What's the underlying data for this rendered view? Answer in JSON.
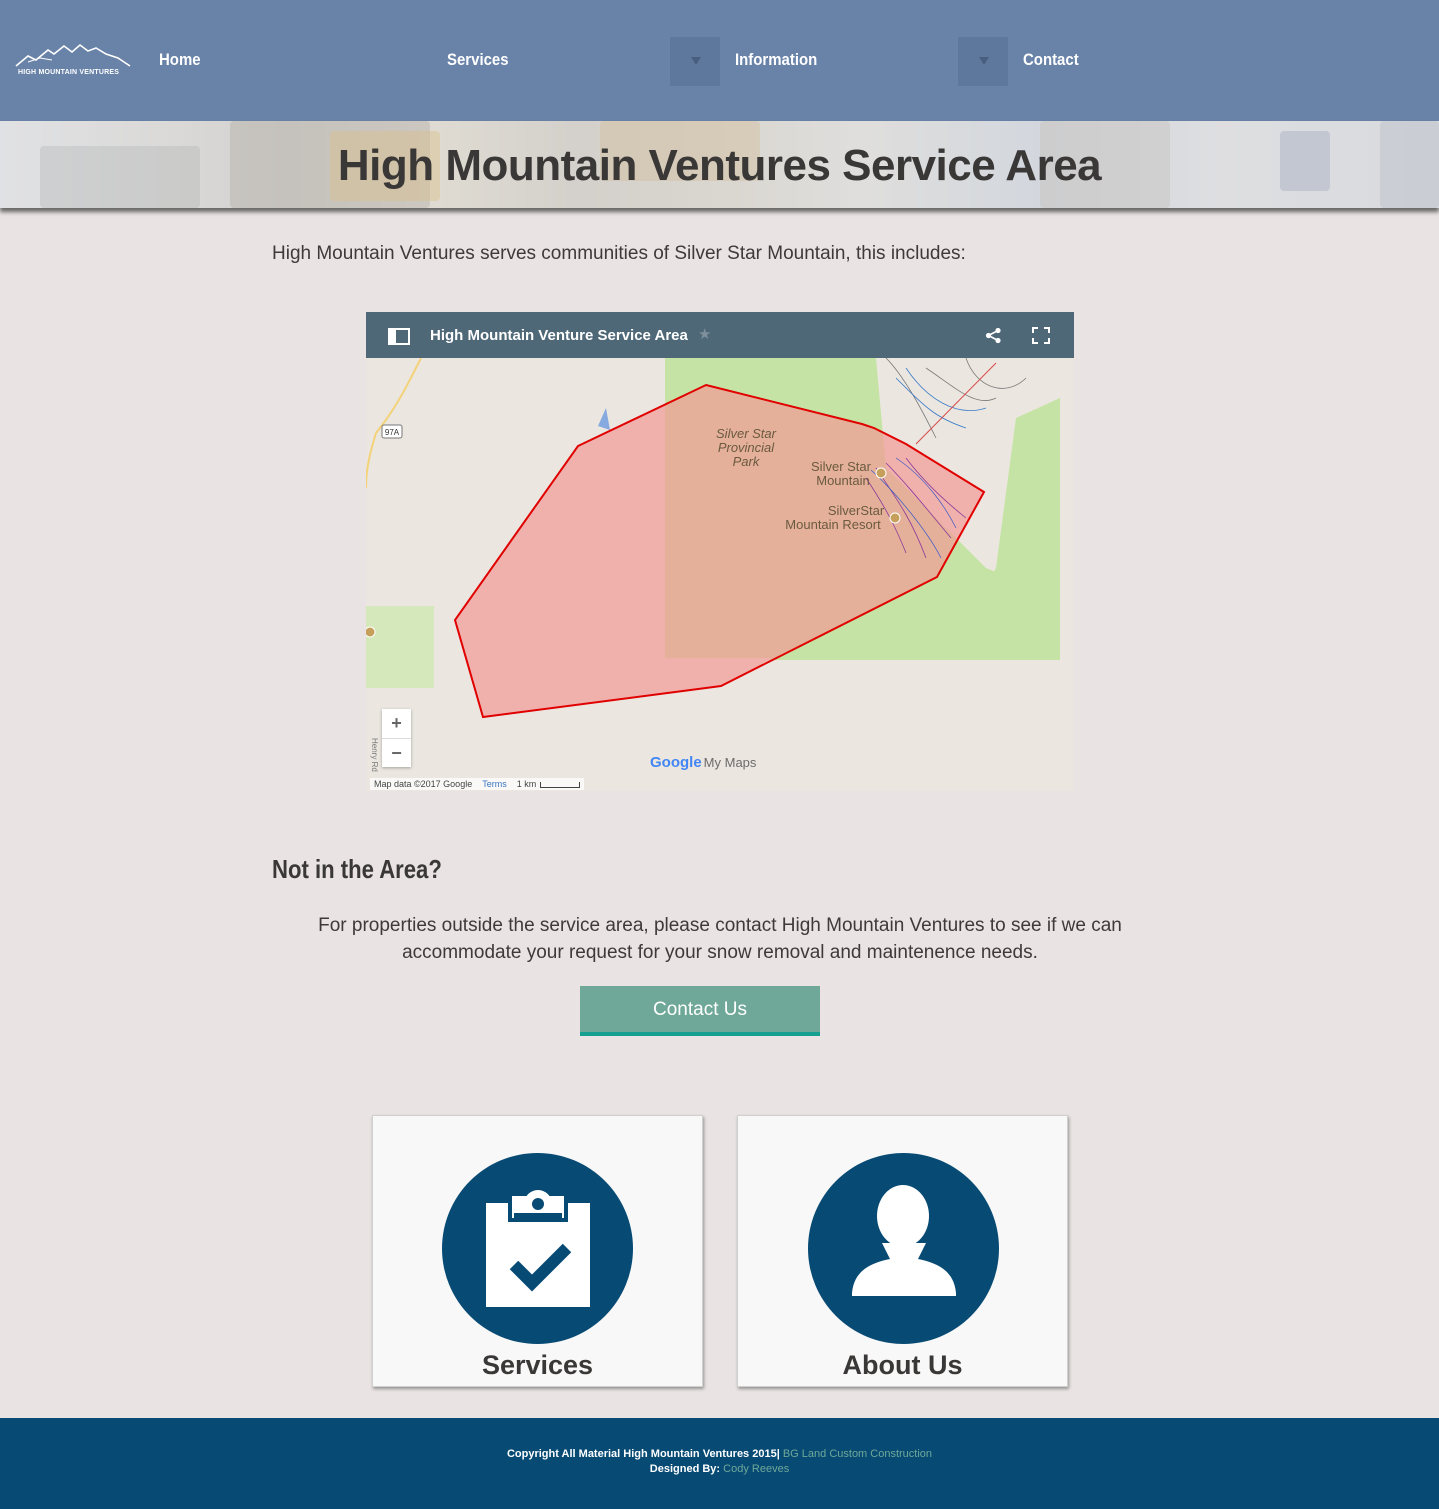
{
  "nav": {
    "logo_text": "HIGH MOUNTAIN VENTURES",
    "items": [
      {
        "label": "Home"
      },
      {
        "label": "Services"
      },
      {
        "label": "Information"
      },
      {
        "label": "Contact"
      }
    ]
  },
  "hero": {
    "title": "High Mountain Ventures Service Area"
  },
  "intro": "High Mountain Ventures serves communities of Silver Star Mountain, this includes:",
  "map": {
    "title": "High Mountain Venture Service Area",
    "labels": {
      "park": [
        "Silver Star",
        "Provincial",
        "Park"
      ],
      "mountain": [
        "Silver Star",
        "Mountain"
      ],
      "resort": [
        "SilverStar",
        "Mountain Resort"
      ],
      "highway": "97A",
      "road": "Henry Rd"
    },
    "zoom_in": "+",
    "zoom_out": "−",
    "attribution": "Map data ©2017 Google",
    "terms": "Terms",
    "scale": "1 km",
    "brand_google": "Google",
    "brand_mymaps": "My Maps"
  },
  "section": {
    "heading": "Not in the Area?",
    "text": "For properties outside the service area, please contact High Mountain Ventures to see if we can accommodate your request for your snow removal and maintenence needs.",
    "button": "Contact Us"
  },
  "cards": [
    {
      "label": "Services",
      "icon": "clipboard-check-icon"
    },
    {
      "label": "About Us",
      "icon": "person-icon"
    }
  ],
  "footer": {
    "copyright": "Copyright All Material High Mountain Ventures 2015|",
    "company_link": "BG Land Custom Construction",
    "designed_by": "Designed By:",
    "designer_link": "Cody Reeves"
  },
  "colors": {
    "nav_bg": "#6882a8",
    "page_bg": "#e9e3e3",
    "accent_teal": "#6fa898",
    "brand_navy": "#074a74",
    "map_bar": "#4f6878",
    "polygon_fill": "#f29a96",
    "polygon_stroke": "#e00000"
  }
}
